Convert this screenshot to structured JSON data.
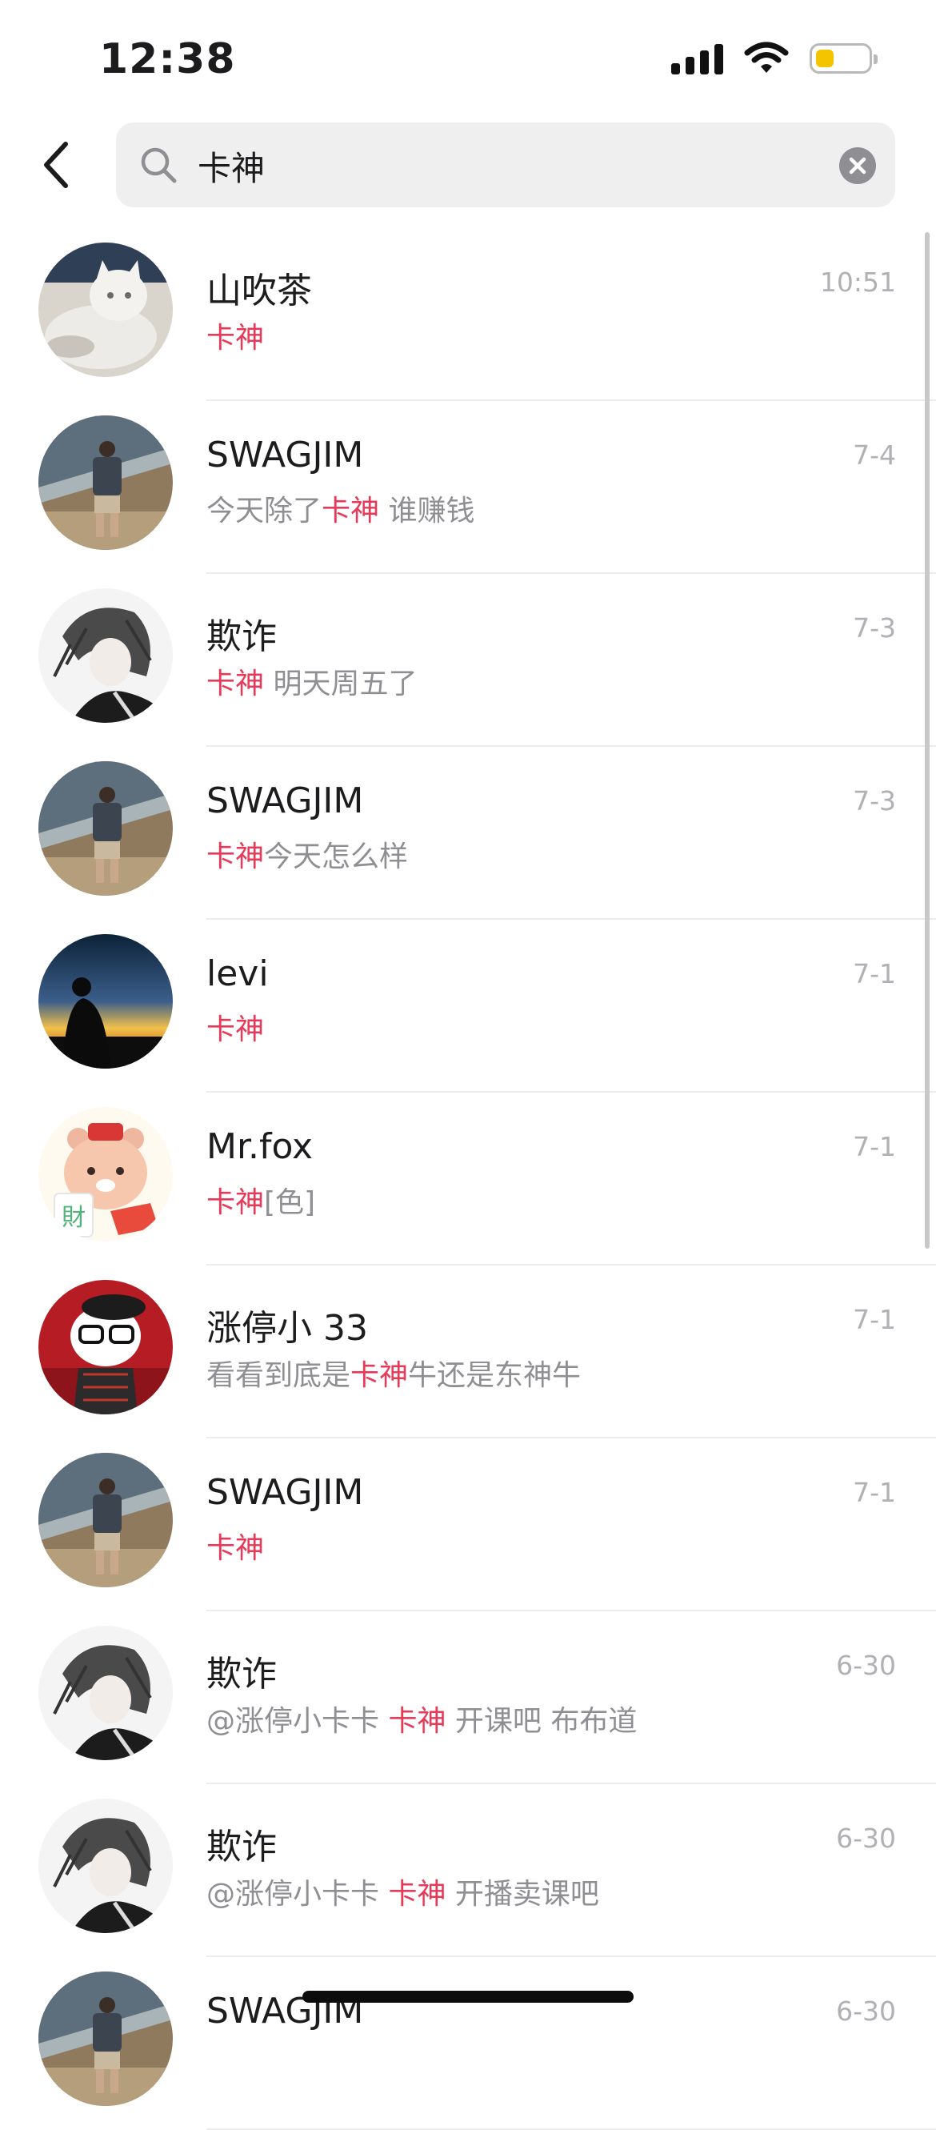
{
  "status_bar": {
    "time": "12:38",
    "battery_level": 0.35,
    "battery_color": "#f5c400"
  },
  "search": {
    "query": "卡神",
    "placeholder": ""
  },
  "colors": {
    "highlight": "#e83a58",
    "timestamp": "#b0b0b5",
    "preview": "#8e8e93"
  },
  "results": [
    {
      "name": "山吹茶",
      "avatar": "white-cat-avatar",
      "time": "10:51",
      "preview": [
        {
          "t": "卡神",
          "hl": true
        }
      ]
    },
    {
      "name": "SWAGJIM",
      "avatar": "man-back-view-avatar",
      "time": "7-4",
      "preview": [
        {
          "t": "今天除了",
          "hl": false
        },
        {
          "t": "卡神",
          "hl": true
        },
        {
          "t": " 谁赚钱",
          "hl": false
        }
      ]
    },
    {
      "name": "欺诈",
      "avatar": "anime-boy-avatar",
      "time": "7-3",
      "preview": [
        {
          "t": "卡神",
          "hl": true
        },
        {
          "t": " 明天周五了",
          "hl": false
        }
      ]
    },
    {
      "name": "SWAGJIM",
      "avatar": "man-back-view-avatar",
      "time": "7-3",
      "preview": [
        {
          "t": "卡神",
          "hl": true
        },
        {
          "t": "今天怎么样",
          "hl": false
        }
      ]
    },
    {
      "name": "levi",
      "avatar": "sunset-silhouette-avatar",
      "time": "7-1",
      "preview": [
        {
          "t": "卡神",
          "hl": true
        }
      ]
    },
    {
      "name": "Mr.fox",
      "avatar": "cartoon-bear-avatar",
      "time": "7-1",
      "preview": [
        {
          "t": "卡神",
          "hl": true
        },
        {
          "t": "[色]",
          "hl": false
        }
      ]
    },
    {
      "name": "涨停小 33",
      "avatar": "hello-kitty-avatar",
      "time": "7-1",
      "preview": [
        {
          "t": "看看到底是",
          "hl": false
        },
        {
          "t": "卡神",
          "hl": true
        },
        {
          "t": "牛还是东神牛",
          "hl": false
        }
      ]
    },
    {
      "name": "SWAGJIM",
      "avatar": "man-back-view-avatar",
      "time": "7-1",
      "preview": [
        {
          "t": "卡神",
          "hl": true
        }
      ]
    },
    {
      "name": "欺诈",
      "avatar": "anime-boy-avatar",
      "time": "6-30",
      "preview": [
        {
          "t": "@涨停小卡卡 ",
          "hl": false
        },
        {
          "t": "卡神",
          "hl": true
        },
        {
          "t": " 开课吧 布布道",
          "hl": false
        }
      ]
    },
    {
      "name": "欺诈",
      "avatar": "anime-boy-avatar",
      "time": "6-30",
      "preview": [
        {
          "t": "@涨停小卡卡 ",
          "hl": false
        },
        {
          "t": "卡神",
          "hl": true
        },
        {
          "t": " 开播卖课吧",
          "hl": false
        }
      ]
    },
    {
      "name": "SWAGJIM",
      "avatar": "man-back-view-avatar",
      "time": "6-30",
      "preview": []
    }
  ]
}
